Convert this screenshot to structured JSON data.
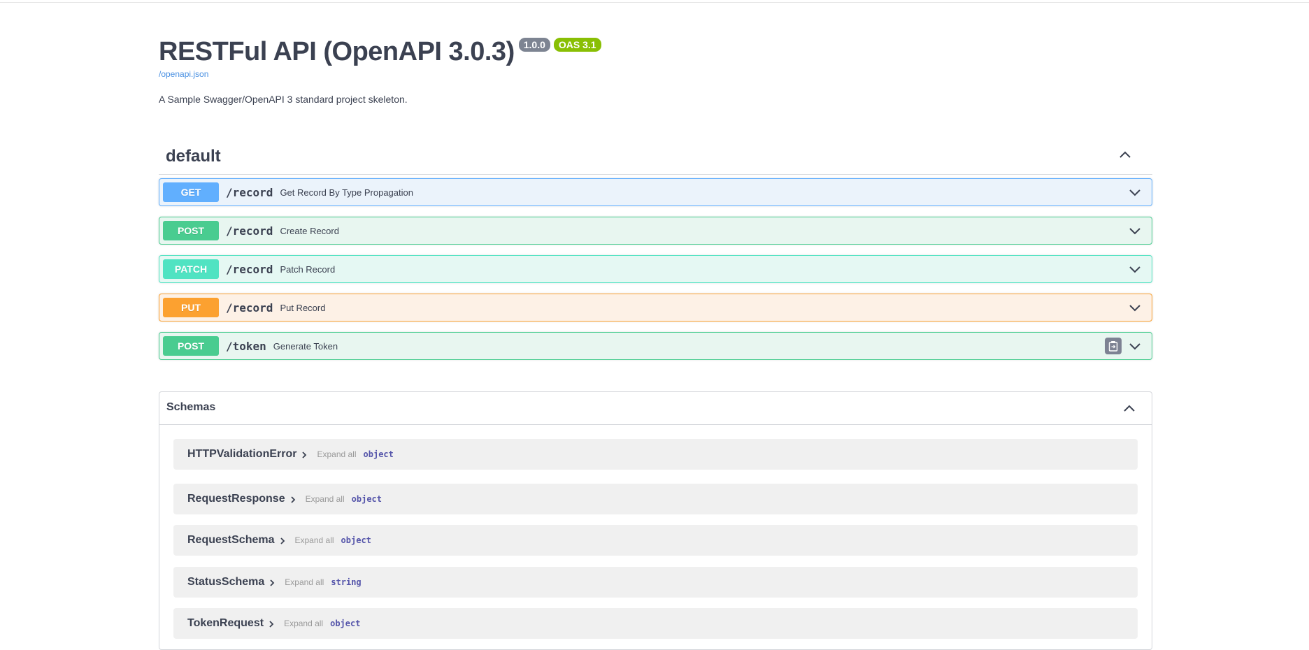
{
  "info": {
    "title": "RESTFul API (OpenAPI 3.0.3)",
    "version_badge": "1.0.0",
    "oas_badge": "OAS 3.1",
    "spec_link": "/openapi.json",
    "description": "A Sample Swagger/OpenAPI 3 standard project skeleton."
  },
  "tag": {
    "name": "default",
    "operations": [
      {
        "method": "GET",
        "path": "/record",
        "summary": "Get Record By Type Propagation",
        "color": "#61affe",
        "bg": "#ebf3fb",
        "border": "#61affe"
      },
      {
        "method": "POST",
        "path": "/record",
        "summary": "Create Record",
        "color": "#49cc90",
        "bg": "#e8f6f0",
        "border": "#49cc90"
      },
      {
        "method": "PATCH",
        "path": "/record",
        "summary": "Patch Record",
        "color": "#50e3c2",
        "bg": "#e5f8f3",
        "border": "#50e3c2"
      },
      {
        "method": "PUT",
        "path": "/record",
        "summary": "Put Record",
        "color": "#fca130",
        "bg": "#fdf1e6",
        "border": "#fca130"
      },
      {
        "method": "POST",
        "path": "/token",
        "summary": "Generate Token",
        "color": "#49cc90",
        "bg": "#e8f6f0",
        "border": "#49cc90"
      }
    ]
  },
  "schemas": {
    "title": "Schemas",
    "expand_all": "Expand all",
    "models": [
      {
        "name": "HTTPValidationError",
        "type": "object"
      },
      {
        "name": "RequestResponse",
        "type": "object"
      },
      {
        "name": "RequestSchema",
        "type": "object"
      },
      {
        "name": "StatusSchema",
        "type": "string"
      },
      {
        "name": "TokenRequest",
        "type": "object"
      }
    ]
  },
  "icons": {
    "collapse": "chevron-up-icon",
    "expand": "chevron-down-icon",
    "model_arrow": "chevron-right-icon",
    "copy": "copy-to-clipboard-icon"
  }
}
